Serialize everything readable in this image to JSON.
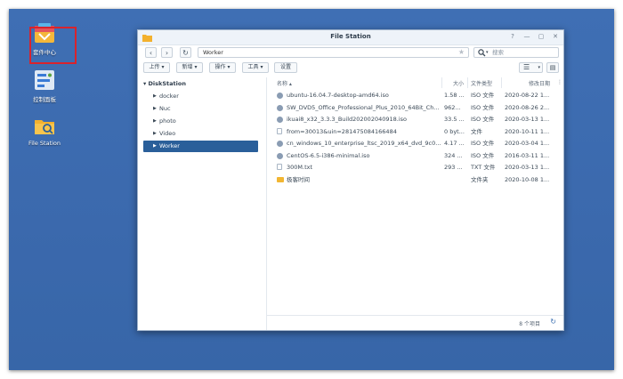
{
  "desktop": {
    "icons": [
      {
        "label": "套件中心"
      },
      {
        "label": "控制面板"
      },
      {
        "label": "File Station"
      }
    ]
  },
  "window": {
    "title": "File Station",
    "controls": [
      "?",
      "—",
      "▢",
      "✕"
    ]
  },
  "navbar": {
    "back": "‹",
    "forward": "›",
    "refresh": "↻",
    "path": "Worker",
    "search_placeholder": "搜索"
  },
  "toolbar": {
    "upload": "上传 ▾",
    "new": "新增 ▾",
    "action": "操作 ▾",
    "tools": "工具 ▾",
    "settings": "设置"
  },
  "sidebar": {
    "root": "DiskStation",
    "items": [
      {
        "label": "docker",
        "selected": false
      },
      {
        "label": "Nuc",
        "selected": false
      },
      {
        "label": "photo",
        "selected": false
      },
      {
        "label": "Video",
        "selected": false
      },
      {
        "label": "Worker",
        "selected": true
      }
    ]
  },
  "list": {
    "headers": {
      "name": "名称 ▴",
      "size": "大小",
      "type": "文件类型",
      "date": "修改日期"
    },
    "rows": [
      {
        "name": "ubuntu-16.04.7-desktop-amd64.iso",
        "size": "1.58 ...",
        "type": "ISO 文件",
        "date": "2020-08-22 1...",
        "icon": "disc-icon"
      },
      {
        "name": "SW_DVD5_Office_Professional_Plus_2010_64Bit_Ch...",
        "size": "962...",
        "type": "ISO 文件",
        "date": "2020-08-26 2...",
        "icon": "disc-icon"
      },
      {
        "name": "ikuai8_x32_3.3.3_Build202002040918.iso",
        "size": "33.5 ...",
        "type": "ISO 文件",
        "date": "2020-03-13 1...",
        "icon": "disc-icon"
      },
      {
        "name": "from=30013&uin=281475084166484",
        "size": "0 byt...",
        "type": "文件",
        "date": "2020-10-11 1...",
        "icon": "document-icon"
      },
      {
        "name": "cn_windows_10_enterprise_ltsc_2019_x64_dvd_9c0...",
        "size": "4.17 ...",
        "type": "ISO 文件",
        "date": "2020-03-04 1...",
        "icon": "disc-icon"
      },
      {
        "name": "CentOS-6.5-i386-minimal.iso",
        "size": "324 ...",
        "type": "ISO 文件",
        "date": "2016-03-11 1...",
        "icon": "disc-icon"
      },
      {
        "name": "300M.txt",
        "size": "293 ...",
        "type": "TXT 文件",
        "date": "2020-03-13 1...",
        "icon": "document-icon"
      },
      {
        "name": "极客时间",
        "size": "",
        "type": "文件夹",
        "date": "2020-10-08 1...",
        "icon": "folder-icon"
      }
    ]
  },
  "footer": {
    "count": "8 个项目",
    "refresh": "↻"
  }
}
